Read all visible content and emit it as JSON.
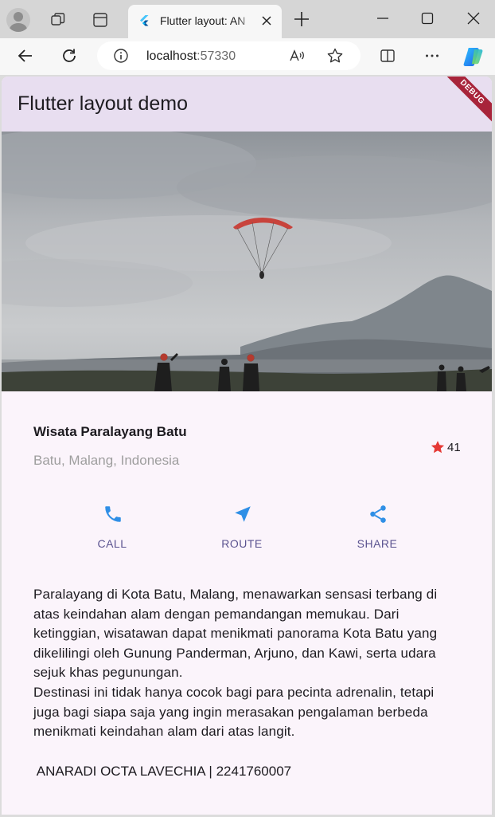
{
  "browser": {
    "tab_title": "Flutter layout: AN",
    "url_host": "localhost",
    "url_port": ":57330"
  },
  "app": {
    "title": "Flutter layout demo",
    "debug_label": "DEBUG",
    "place": {
      "name": "Wisata Paralayang Batu",
      "location": "Batu, Malang, Indonesia",
      "rating": "41"
    },
    "actions": [
      {
        "label": "CALL",
        "icon": "phone-icon"
      },
      {
        "label": "ROUTE",
        "icon": "navigation-icon"
      },
      {
        "label": "SHARE",
        "icon": "share-icon"
      }
    ],
    "description": [
      "Paralayang di Kota Batu, Malang, menawarkan sensasi terbang di atas keindahan alam dengan pemandangan memukau. Dari ketinggian, wisatawan dapat menikmati panorama Kota Batu yang dikelilingi oleh Gunung Panderman, Arjuno, dan Kawi, serta udara sejuk khas pegunungan.",
      "Destinasi ini tidak hanya cocok bagi para pecinta adrenalin, tetapi juga bagi siapa saja yang ingin merasakan pengalaman berbeda menikmati keindahan alam dari atas langit."
    ],
    "footer": " ANARADI OCTA LAVECHIA | 2241760007"
  },
  "colors": {
    "accent": "#2f8fe6",
    "star": "#e53935",
    "button_label": "#5b5390",
    "appbar": "#e8def0",
    "background": "#fbf4fb"
  }
}
